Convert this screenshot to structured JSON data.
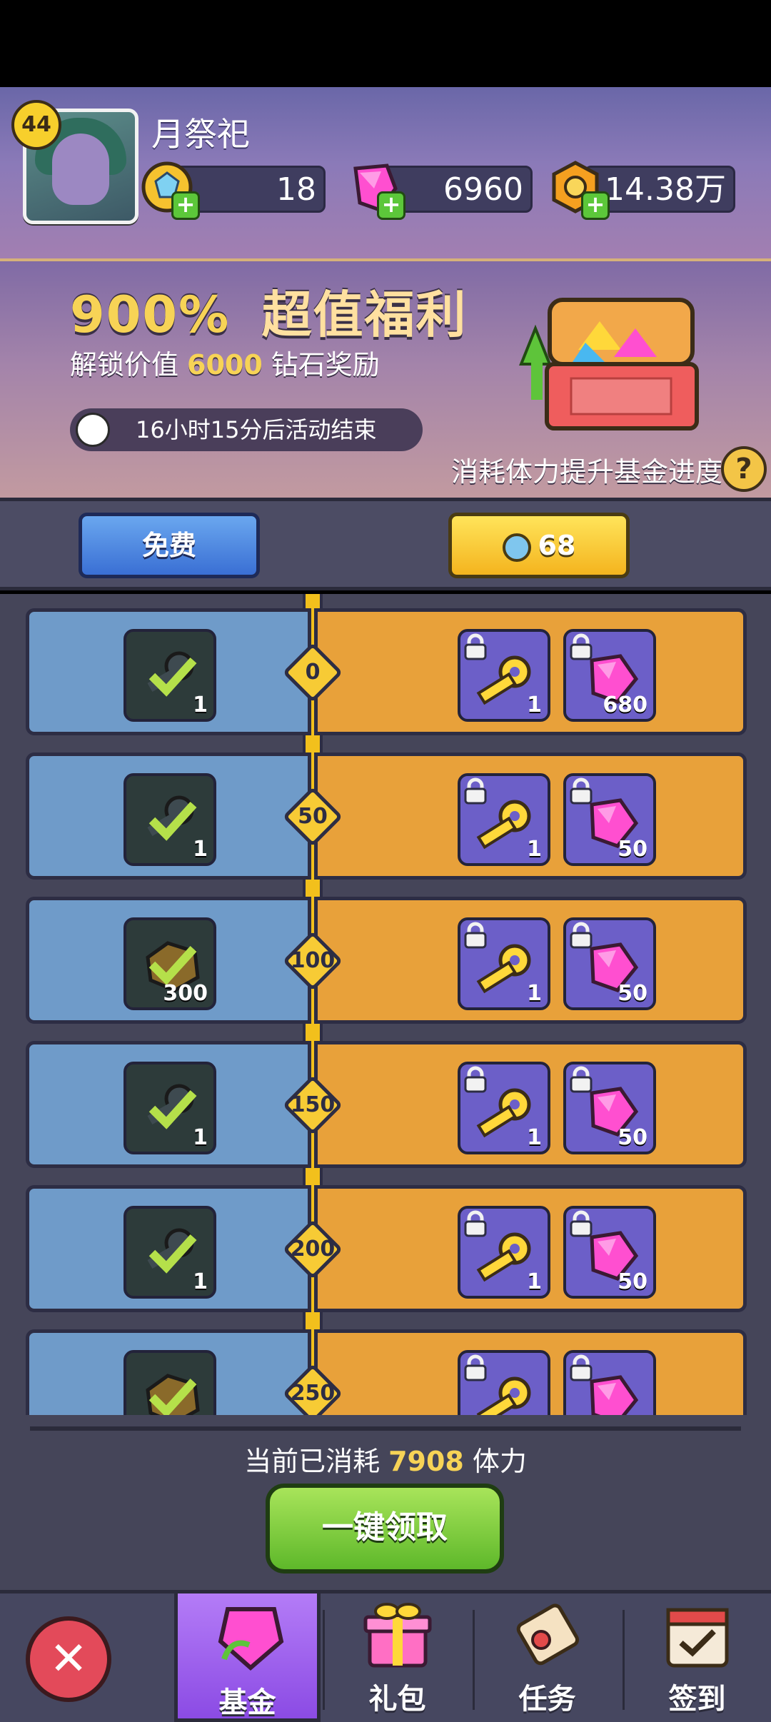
{
  "player": {
    "name": "月祭祀",
    "level": "44"
  },
  "resources": [
    {
      "name": "energy",
      "icon": "blue-gem-coin-icon",
      "value": "18"
    },
    {
      "name": "diamonds",
      "icon": "pink-diamond-icon",
      "value": "6960"
    },
    {
      "name": "gold",
      "icon": "gold-coin-icon",
      "value": "14.38万"
    }
  ],
  "banner": {
    "title_pct": "900%",
    "title_rest": "超值福利",
    "sub_prefix": "解锁价值",
    "sub_value": "6000",
    "sub_suffix": "钻石奖励",
    "timer": "16小时15分后活动结束",
    "tip": "消耗体力提升基金进度",
    "help": "?"
  },
  "tracks": {
    "free_label": "免费",
    "paid_price": "68"
  },
  "rows": [
    {
      "milestone": "0",
      "free_icon": "grey-key-icon",
      "free_count": "1",
      "key_count": "1",
      "gem_count": "680"
    },
    {
      "milestone": "50",
      "free_icon": "grey-key-icon",
      "free_count": "1",
      "key_count": "1",
      "gem_count": "50"
    },
    {
      "milestone": "100",
      "free_icon": "ore-rock-icon",
      "free_count": "300",
      "key_count": "1",
      "gem_count": "50"
    },
    {
      "milestone": "150",
      "free_icon": "grey-key-icon",
      "free_count": "1",
      "key_count": "1",
      "gem_count": "50"
    },
    {
      "milestone": "200",
      "free_icon": "grey-key-icon",
      "free_count": "1",
      "key_count": "1",
      "gem_count": "50"
    },
    {
      "milestone": "250",
      "free_icon": "ore-rock-icon",
      "free_count": "",
      "key_count": "",
      "gem_count": ""
    }
  ],
  "footer": {
    "consumed_prefix": "当前已消耗",
    "consumed_value": "7908",
    "consumed_suffix": "体力",
    "claim_all": "一键领取"
  },
  "nav": {
    "close": "✕",
    "tabs": [
      {
        "label": "基金",
        "icon": "pink-gem-fund-icon",
        "active": true
      },
      {
        "label": "礼包",
        "icon": "gift-box-icon",
        "active": false
      },
      {
        "label": "任务",
        "icon": "scroll-quest-icon",
        "active": false
      },
      {
        "label": "签到",
        "icon": "calendar-checkin-icon",
        "active": false
      }
    ]
  },
  "colors": {
    "free_track": "#6f9bc9",
    "paid_track": "#e8a13a",
    "accent": "#f7d356",
    "active_tab": "#9b5cf0"
  }
}
